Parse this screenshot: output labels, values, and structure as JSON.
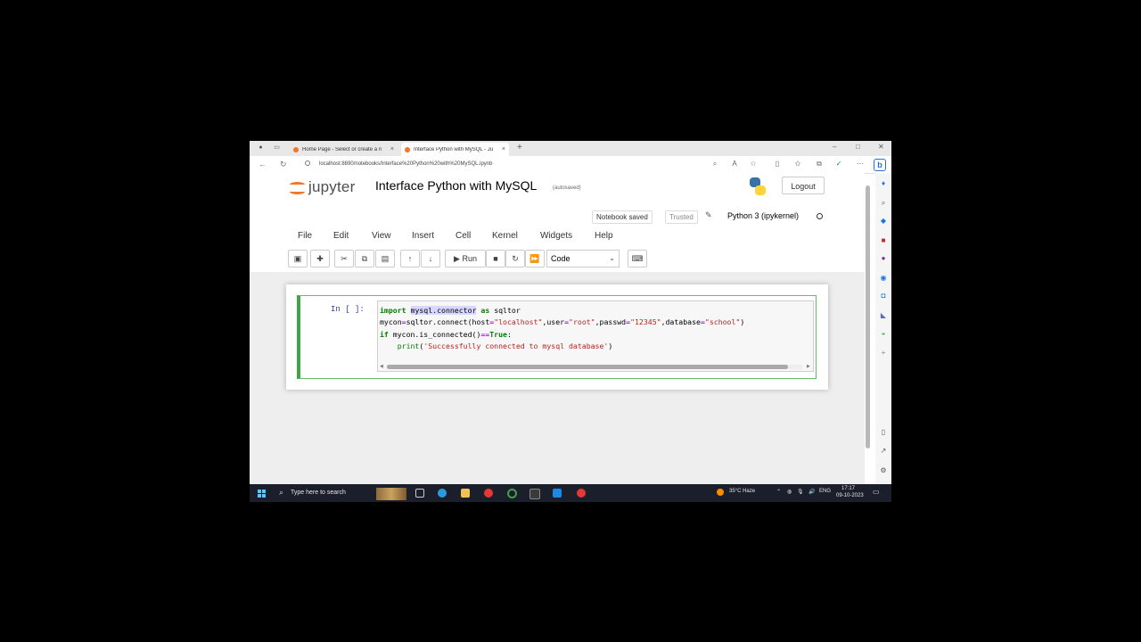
{
  "browser": {
    "tabs": [
      {
        "title": "Home Page - Select or create a n",
        "active": false
      },
      {
        "title": "Interface Python with MySQL - Ju",
        "active": true
      }
    ],
    "url": "localhost:8890/notebooks/Interface%20Python%20with%20MySQL.ipynb"
  },
  "jupyter": {
    "logo_text": "jupyter",
    "notebook_title": "Interface Python with MySQL",
    "autosave_status": "(autosaved)",
    "logout_label": "Logout",
    "notebook_saved": "Notebook saved",
    "trusted": "Trusted",
    "kernel_name": "Python 3 (ipykernel)",
    "menu": [
      "File",
      "Edit",
      "View",
      "Insert",
      "Cell",
      "Kernel",
      "Widgets",
      "Help"
    ],
    "toolbar": {
      "run_label": "Run",
      "cell_type": "Code"
    },
    "cell": {
      "prompt": "In [ ]:"
    }
  },
  "taskbar": {
    "search_placeholder": "Type here to search",
    "weather": "35°C  Haze",
    "language": "ENG",
    "time": "17:17",
    "date": "09-10-2023"
  },
  "colors": {
    "jupyter_orange": "#f37626",
    "cell_border": "#42a545",
    "taskbar_bg": "#1b1e2b"
  }
}
